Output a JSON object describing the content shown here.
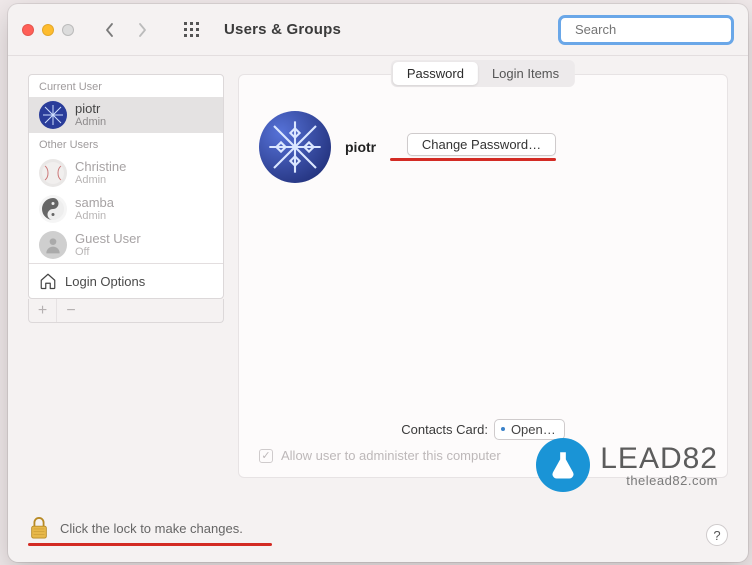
{
  "toolbar": {
    "title": "Users & Groups",
    "search_placeholder": "Search"
  },
  "sidebar": {
    "current_label": "Current User",
    "other_label": "Other Users",
    "current": {
      "name": "piotr",
      "role": "Admin"
    },
    "others": [
      {
        "name": "Christine",
        "role": "Admin"
      },
      {
        "name": "samba",
        "role": "Admin"
      },
      {
        "name": "Guest User",
        "role": "Off"
      }
    ],
    "login_options": "Login Options"
  },
  "tabs": {
    "password": "Password",
    "login_items": "Login Items"
  },
  "profile": {
    "name": "piotr",
    "change_pw": "Change Password…"
  },
  "contacts": {
    "label": "Contacts Card:",
    "open": "Open…"
  },
  "admin_checkbox": "Allow user to administer this computer",
  "footer": {
    "lock_text": "Click the lock to make changes.",
    "help": "?"
  },
  "watermark": {
    "big": "LEAD82",
    "small": "thelead82.com"
  }
}
